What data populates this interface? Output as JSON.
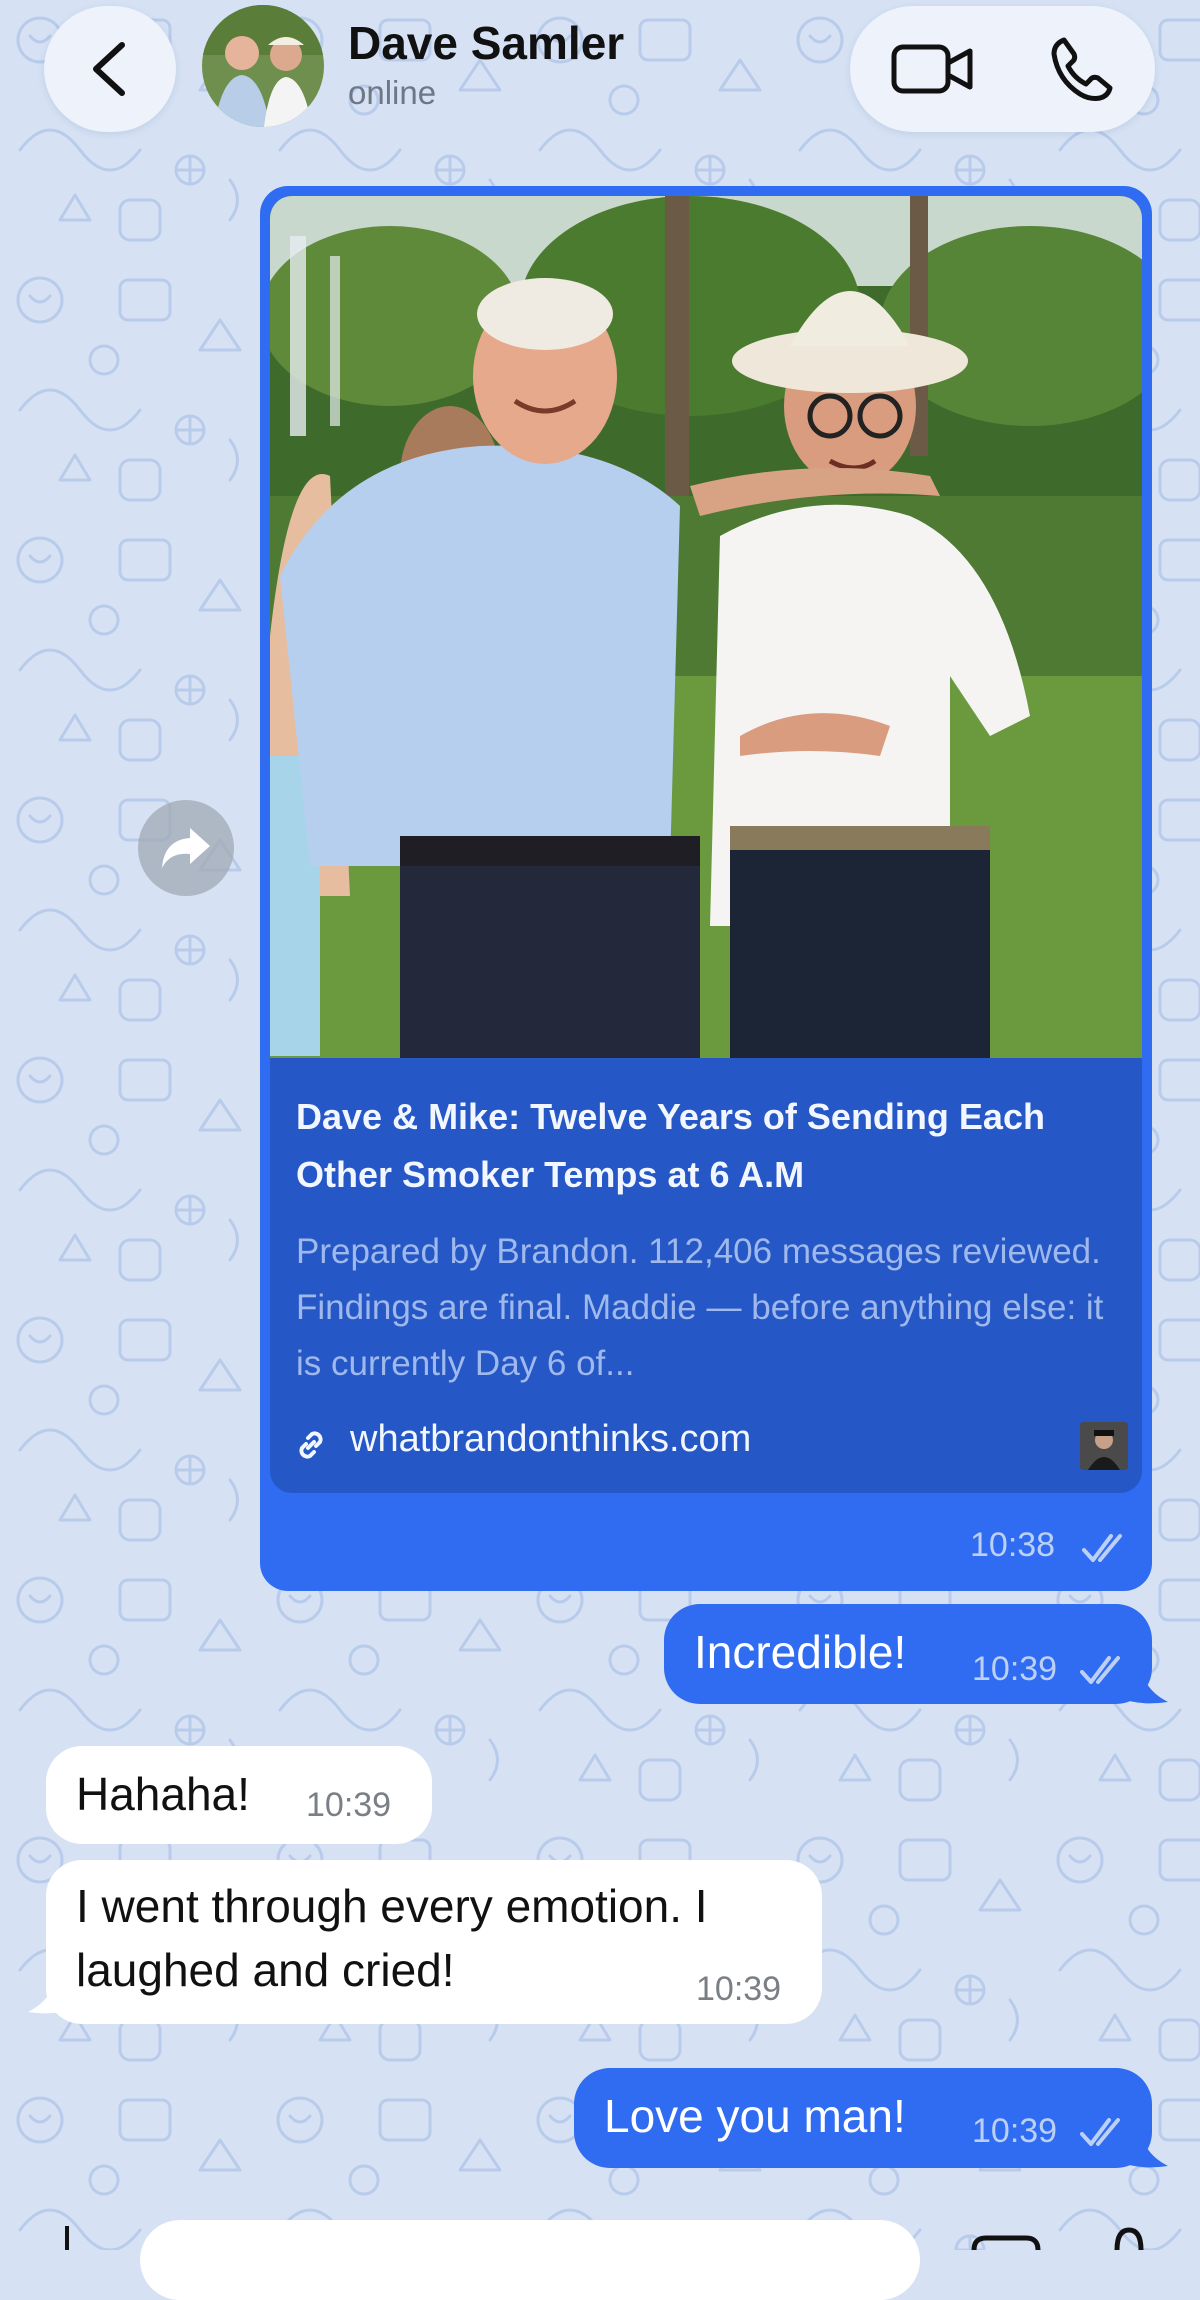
{
  "header": {
    "contact_name": "Dave Samler",
    "contact_status": "online"
  },
  "link_message": {
    "title": "Dave & Mike: Twelve Years of Sending Each Other Smoker Temps at 6 A.M",
    "description": "Prepared by Brandon. 112,406 messages reviewed. Findings are final. Maddie — before anything else: it is currently Day 6 of...",
    "url": "whatbrandonthinks.com",
    "time": "10:38",
    "status": "read"
  },
  "messages": [
    {
      "direction": "out",
      "text": "Incredible!",
      "time": "10:39",
      "status": "read"
    },
    {
      "direction": "in",
      "text": "Hahaha!",
      "time": "10:39"
    },
    {
      "direction": "in",
      "text_line1": "I went through every emotion. I",
      "text_line2": "laughed and cried!",
      "time": "10:39"
    },
    {
      "direction": "out",
      "text": "Love you man!",
      "time": "10:39",
      "status": "read"
    }
  ],
  "colors": {
    "outgoing_bubble": "#2f6cf1",
    "incoming_bubble": "#ffffff",
    "link_card_inner": "#2557c6",
    "wallpaper": "#d6e2f4"
  },
  "icons": {
    "back": "chevron-left-icon",
    "video": "video-camera-icon",
    "phone": "phone-icon",
    "forward": "share-forward-icon",
    "link": "link-icon",
    "read": "double-check-icon"
  }
}
